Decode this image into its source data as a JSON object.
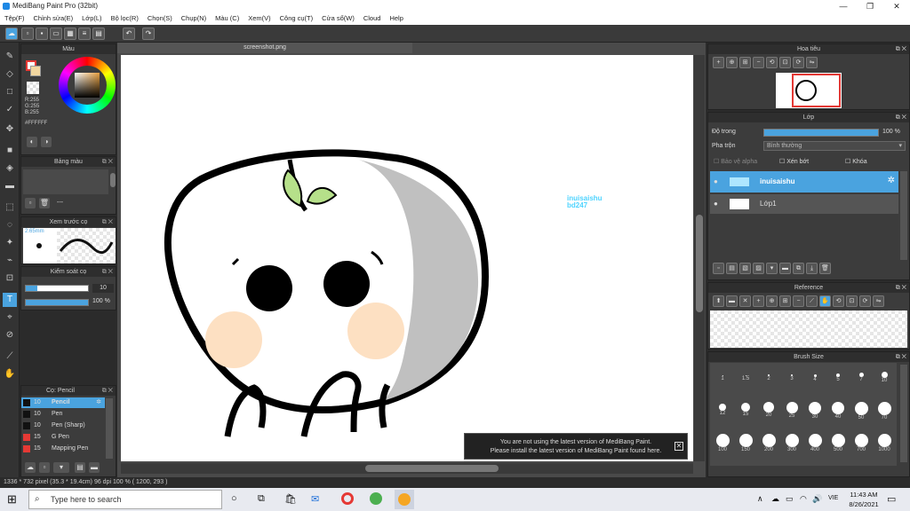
{
  "window": {
    "title": "MediBang Paint Pro (32bit)",
    "controls": [
      "—",
      "❐",
      "✕"
    ]
  },
  "menu": [
    "Tệp(F)",
    "Chỉnh sửa(E)",
    "Lớp(L)",
    "Bộ lọc(R)",
    "Chọn(S)",
    "Chụp(N)",
    "Màu (C)",
    "Xem(V)",
    "Công cụ(T)",
    "Cửa sổ(W)",
    "Cloud",
    "Help"
  ],
  "colors": {
    "accent": "#4aa3df",
    "panel_bg": "#3c3c3c",
    "dark": "#2b2b2b"
  },
  "document": {
    "tab": "screenshot.png",
    "watermark_line1": "inuisaishu",
    "watermark_line2": "bd247"
  },
  "color_panel": {
    "title": "Màu",
    "rgb": [
      "R:255",
      "G:255",
      "B:255"
    ],
    "hex": "#FFFFFF"
  },
  "palette_panel": {
    "title": "Bảng màu",
    "dash": "---"
  },
  "preview_panel": {
    "title": "Xem trước cọ",
    "size": "2.65mm"
  },
  "brush_control": {
    "title": "Kiểm soát cọ",
    "size_value": "10",
    "opacity_value": "100 %"
  },
  "brush_list": {
    "title": "Cọ: Pencil",
    "items": [
      {
        "size": "10",
        "name": "Pencil",
        "color": "#111111",
        "selected": true
      },
      {
        "size": "10",
        "name": "Pen",
        "color": "#111111",
        "selected": false
      },
      {
        "size": "10",
        "name": "Pen (Sharp)",
        "color": "#111111",
        "selected": false
      },
      {
        "size": "15",
        "name": "G Pen",
        "color": "#e53935",
        "selected": false
      },
      {
        "size": "15",
        "name": "Mapping Pen",
        "color": "#e53935",
        "selected": false
      }
    ]
  },
  "navigator": {
    "title": "Hoa tiêu"
  },
  "layer_panel": {
    "title": "Lớp",
    "opacity_label": "Độ trong",
    "opacity_value": "100 %",
    "blend_label": "Pha trộn",
    "blend_value": "Bình thường",
    "protect_alpha": "Bảo vệ alpha",
    "clipping": "Xén bớt",
    "lock": "Khóa",
    "layers": [
      {
        "name": "inuisaishu",
        "selected": true
      },
      {
        "name": "Lớp1",
        "selected": false
      }
    ]
  },
  "reference": {
    "title": "Reference"
  },
  "brush_size": {
    "title": "Brush Size",
    "rows": [
      [
        "1",
        "1.5",
        "2",
        "3",
        "4",
        "5",
        "7",
        "10"
      ],
      [
        "12",
        "15",
        "20",
        "25",
        "30",
        "40",
        "50",
        "70"
      ],
      [
        "100",
        "150",
        "200",
        "300",
        "400",
        "500",
        "700",
        "1000"
      ]
    ]
  },
  "notice": {
    "line1": "You are not using the latest version of MediBang Paint.",
    "line2": "Please install the latest version of MediBang Paint found here."
  },
  "status": {
    "text": "1336 * 732 pixel   (35.3 * 19.4cm)   96 dpi   100 %   ( 1200, 293 )"
  },
  "taskbar": {
    "search_placeholder": "Type here to search",
    "time": "11:43 AM",
    "date": "8/26/2021",
    "lang": "VIE"
  }
}
